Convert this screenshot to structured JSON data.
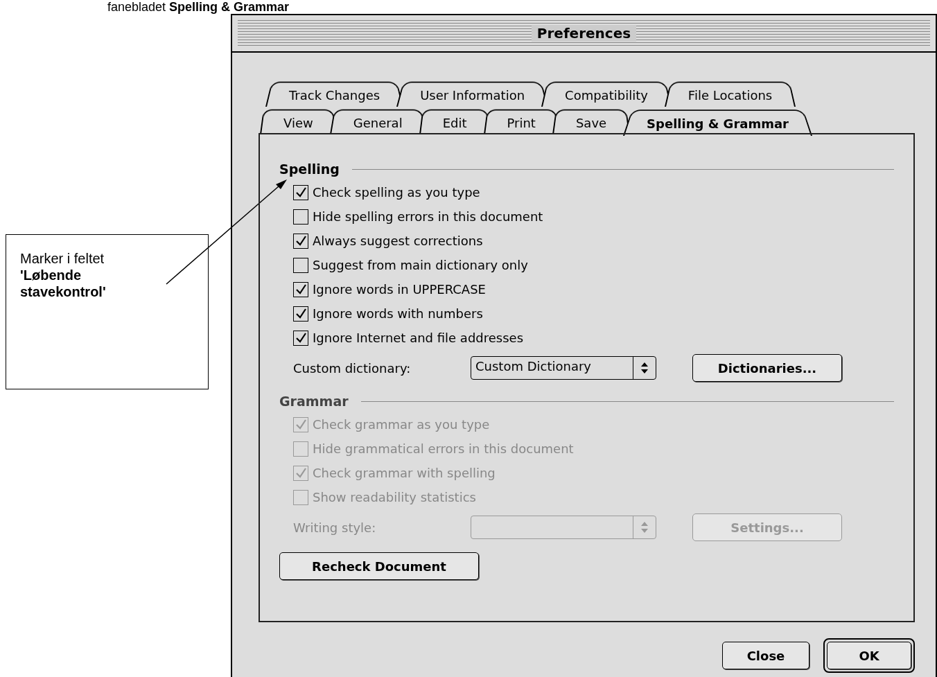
{
  "caption": {
    "text": "fanebladet **Spelling & Grammar**"
  },
  "callout": {
    "text": "Marker i feltet **'Løbende stavekontrol'**"
  },
  "window": {
    "title": "Preferences"
  },
  "tab_rows": [
    {
      "tabs": [
        {
          "label": "Track Changes",
          "selected": false
        },
        {
          "label": "User Information",
          "selected": false
        },
        {
          "label": "Compatibility",
          "selected": false
        },
        {
          "label": "File Locations",
          "selected": false
        }
      ]
    },
    {
      "tabs": [
        {
          "label": "View",
          "selected": false
        },
        {
          "label": "General",
          "selected": false
        },
        {
          "label": "Edit",
          "selected": false
        },
        {
          "label": "Print",
          "selected": false
        },
        {
          "label": "Save",
          "selected": false
        },
        {
          "label": "Spelling & Grammar",
          "selected": true
        }
      ]
    }
  ],
  "sections": [
    {
      "heading": "Spelling",
      "disabled": false,
      "options": [
        {
          "label": "Check spelling as you type",
          "checked": true
        },
        {
          "label": "Hide spelling errors in this document",
          "checked": false
        },
        {
          "label": "Always suggest corrections",
          "checked": true
        },
        {
          "label": "Suggest from main dictionary only",
          "checked": false
        },
        {
          "label": "Ignore words in UPPERCASE",
          "checked": true
        },
        {
          "label": "Ignore words with numbers",
          "checked": true
        },
        {
          "label": "Ignore Internet and file addresses",
          "checked": true
        }
      ],
      "dropdown": {
        "label": "Custom dictionary:",
        "value": "Custom Dictionary"
      },
      "button": {
        "label": "Dictionaries..."
      }
    },
    {
      "heading": "Grammar",
      "disabled": true,
      "options": [
        {
          "label": "Check grammar as you type",
          "checked": true
        },
        {
          "label": "Hide grammatical errors in this document",
          "checked": false
        },
        {
          "label": "Check grammar with spelling",
          "checked": true
        },
        {
          "label": "Show readability statistics",
          "checked": false
        }
      ],
      "dropdown": {
        "label": "Writing style:"
      },
      "button": {
        "label": "Settings..."
      }
    }
  ],
  "recheck_button": {
    "label": "Recheck Document"
  },
  "buttons": [
    {
      "label": "Close",
      "default": false
    },
    {
      "label": "OK",
      "default": true
    }
  ]
}
